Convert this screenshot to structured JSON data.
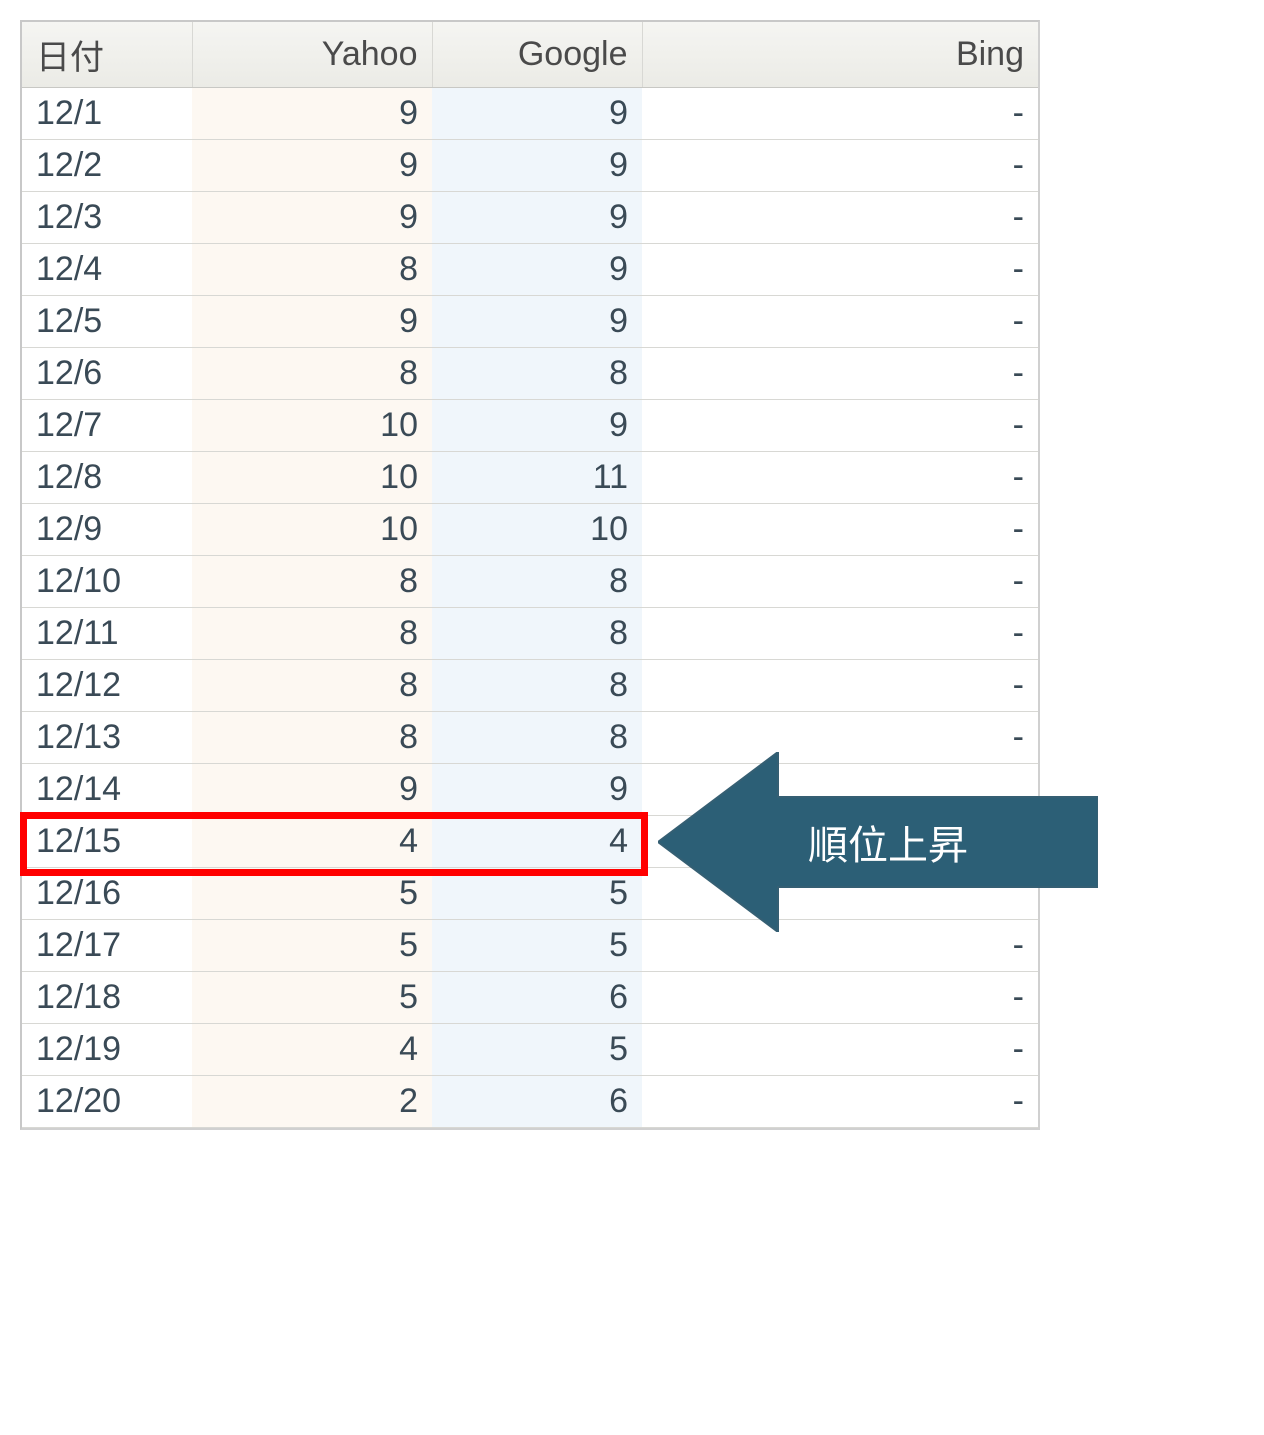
{
  "table": {
    "headers": {
      "date": "日付",
      "yahoo": "Yahoo",
      "google": "Google",
      "bing": "Bing"
    },
    "rows": [
      {
        "date": "12/1",
        "yahoo": "9",
        "google": "9",
        "bing": "-"
      },
      {
        "date": "12/2",
        "yahoo": "9",
        "google": "9",
        "bing": "-"
      },
      {
        "date": "12/3",
        "yahoo": "9",
        "google": "9",
        "bing": "-"
      },
      {
        "date": "12/4",
        "yahoo": "8",
        "google": "9",
        "bing": "-"
      },
      {
        "date": "12/5",
        "yahoo": "9",
        "google": "9",
        "bing": "-"
      },
      {
        "date": "12/6",
        "yahoo": "8",
        "google": "8",
        "bing": "-"
      },
      {
        "date": "12/7",
        "yahoo": "10",
        "google": "9",
        "bing": "-"
      },
      {
        "date": "12/8",
        "yahoo": "10",
        "google": "11",
        "bing": "-"
      },
      {
        "date": "12/9",
        "yahoo": "10",
        "google": "10",
        "bing": "-"
      },
      {
        "date": "12/10",
        "yahoo": "8",
        "google": "8",
        "bing": "-"
      },
      {
        "date": "12/11",
        "yahoo": "8",
        "google": "8",
        "bing": "-"
      },
      {
        "date": "12/12",
        "yahoo": "8",
        "google": "8",
        "bing": "-"
      },
      {
        "date": "12/13",
        "yahoo": "8",
        "google": "8",
        "bing": "-"
      },
      {
        "date": "12/14",
        "yahoo": "9",
        "google": "9",
        "bing": ""
      },
      {
        "date": "12/15",
        "yahoo": "4",
        "google": "4",
        "bing": "",
        "highlighted": true
      },
      {
        "date": "12/16",
        "yahoo": "5",
        "google": "5",
        "bing": ""
      },
      {
        "date": "12/17",
        "yahoo": "5",
        "google": "5",
        "bing": "-"
      },
      {
        "date": "12/18",
        "yahoo": "5",
        "google": "6",
        "bing": "-"
      },
      {
        "date": "12/19",
        "yahoo": "4",
        "google": "5",
        "bing": "-"
      },
      {
        "date": "12/20",
        "yahoo": "2",
        "google": "6",
        "bing": "-"
      }
    ]
  },
  "callout": {
    "label": "順位上昇",
    "arrow_color": "#2c5f76",
    "highlight_color": "#ff0000"
  }
}
